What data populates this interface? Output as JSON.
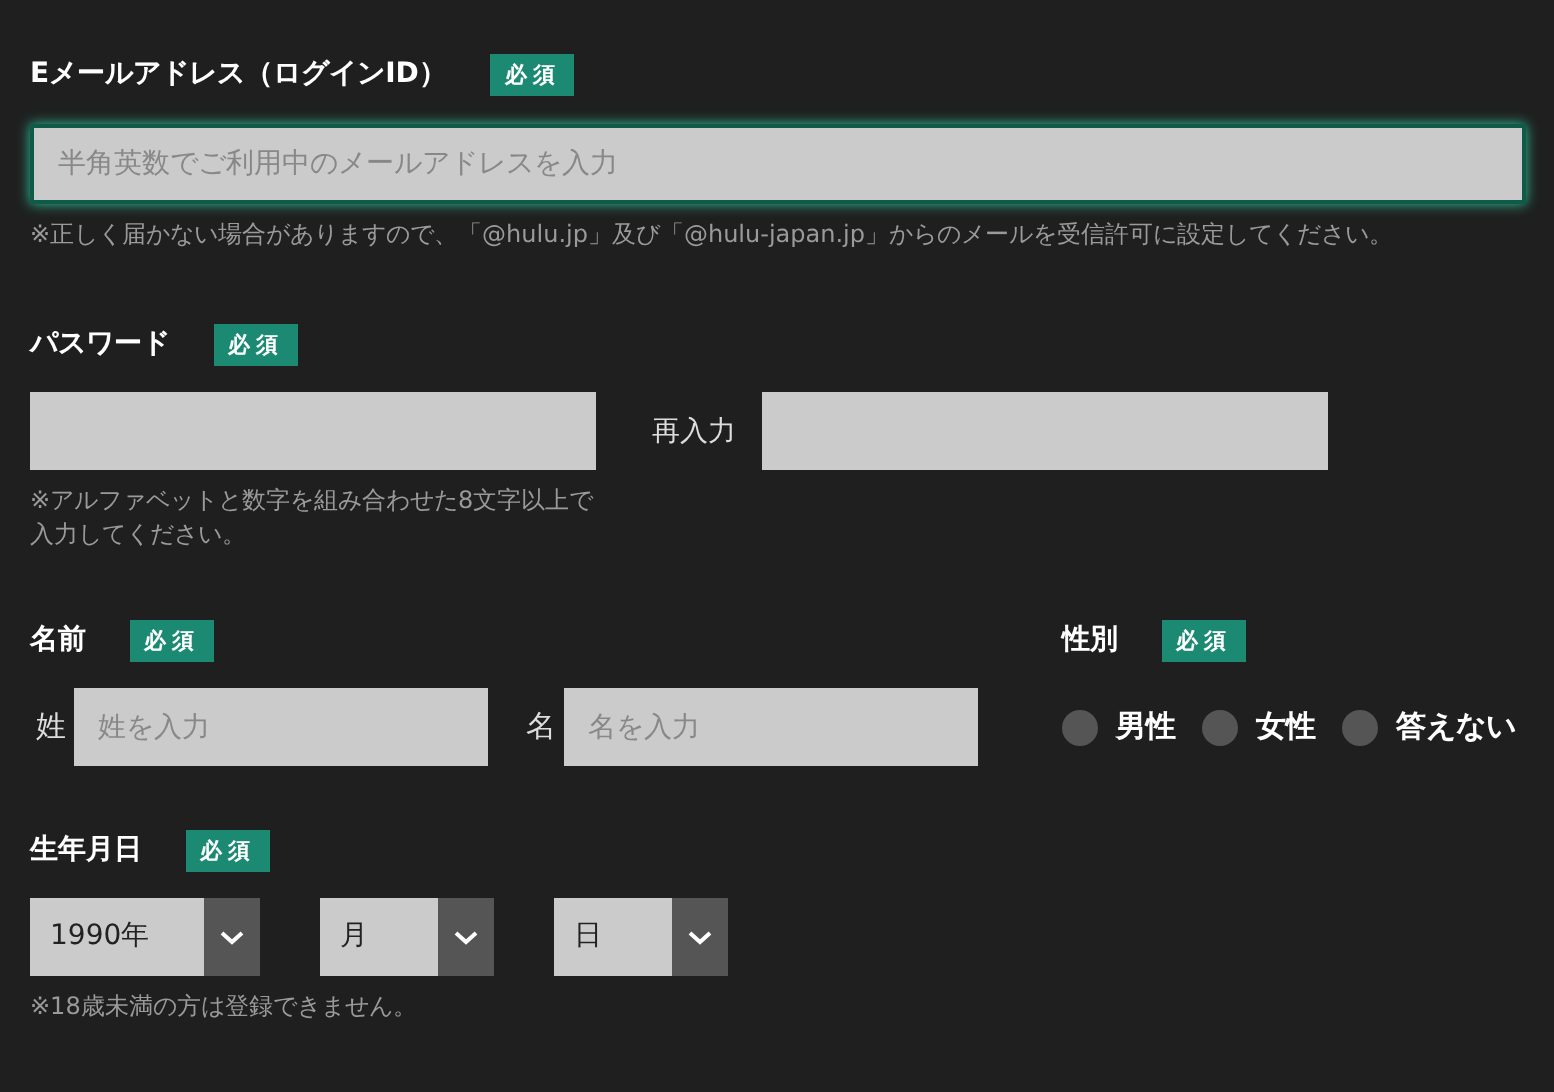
{
  "email": {
    "label": "Eメールアドレス（ログインID）",
    "badge": "必須",
    "placeholder": "半角英数でご利用中のメールアドレスを入力",
    "focused": true,
    "note": "※正しく届かない場合がありますので、「@hulu.jp」及び「@hulu-japan.jp」からのメールを受信許可に設定してください。"
  },
  "password": {
    "label": "パスワード",
    "badge": "必須",
    "confirm_label": "再入力",
    "note": "※アルファベットと数字を組み合わせた8文字以上で入力してください。"
  },
  "name": {
    "label": "名前",
    "badge": "必須",
    "fields": [
      {
        "label": "姓",
        "placeholder": "姓を入力"
      },
      {
        "label": "名",
        "placeholder": "名を入力"
      }
    ]
  },
  "gender": {
    "label": "性別",
    "badge": "必須",
    "options": [
      {
        "label": "男性",
        "selected": false
      },
      {
        "label": "女性",
        "selected": false
      },
      {
        "label": "答えない",
        "selected": false
      }
    ]
  },
  "birthdate": {
    "label": "生年月日",
    "badge": "必須",
    "selects": [
      {
        "value": "1990年"
      },
      {
        "value": "月"
      },
      {
        "value": "日"
      }
    ],
    "note": "※18歳未満の方は登録できません。"
  }
}
